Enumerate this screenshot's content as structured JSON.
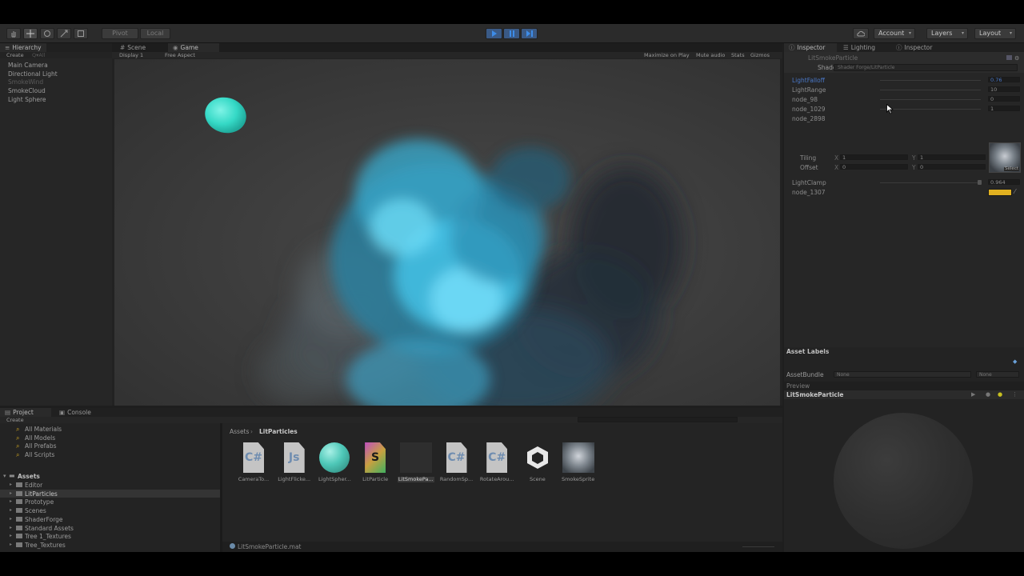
{
  "toolbar": {
    "pivot_label": "Pivot",
    "local_label": "Local",
    "account_label": "Account",
    "layers_label": "Layers",
    "layout_label": "Layout"
  },
  "hierarchy": {
    "tab_label": "Hierarchy",
    "create_label": "Create",
    "search_placeholder": "Q▾All",
    "items": [
      {
        "label": "Main Camera",
        "dim": false
      },
      {
        "label": "Directional Light",
        "dim": false
      },
      {
        "label": "SmokeWind",
        "dim": true
      },
      {
        "label": "SmokeCloud",
        "dim": false
      },
      {
        "label": "Light Sphere",
        "dim": false
      }
    ]
  },
  "view": {
    "scene_tab": "Scene",
    "game_tab": "Game",
    "display_label": "Display 1",
    "aspect_label": "Free Aspect",
    "maximize_label": "Maximize on Play",
    "mute_label": "Mute audio",
    "stats_label": "Stats",
    "gizmos_label": "Gizmos"
  },
  "inspector": {
    "tab_inspector": "Inspector",
    "tab_lighting": "Lighting",
    "tab_inspector2": "Inspector",
    "material_name": "LitSmokeParticle",
    "shader_label": "Shader",
    "shader_value": "Shader Forge/LitParticle",
    "props": [
      {
        "label": "LightFalloff",
        "value": "0.76",
        "highlight": true
      },
      {
        "label": "LightRange",
        "value": "10",
        "highlight": false
      },
      {
        "label": "node_98",
        "value": "0",
        "highlight": false
      },
      {
        "label": "node_1029",
        "value": "1",
        "highlight": false
      },
      {
        "label": "node_2898",
        "value": "",
        "highlight": false
      }
    ],
    "tiling_label": "Tiling",
    "offset_label": "Offset",
    "tiling_x": "1",
    "tiling_y": "1",
    "offset_x": "0",
    "offset_y": "0",
    "x_label": "X",
    "y_label": "Y",
    "select_label": "Select",
    "lightclamp_label": "LightClamp",
    "lightclamp_value": "0.964",
    "node1307_label": "node_1307",
    "color_swatch": "#e0b020",
    "asset_labels": "Asset Labels",
    "assetbundle_label": "AssetBundle",
    "assetbundle_value": "None",
    "assetbundle_variant": "None",
    "preview_label": "Preview",
    "preview_title": "LitSmokeParticle"
  },
  "project": {
    "tab_project": "Project",
    "tab_console": "Console",
    "create_label": "Create",
    "favorites": [
      "All Materials",
      "All Models",
      "All Prefabs",
      "All Scripts"
    ],
    "assets_root": "Assets",
    "folders": [
      {
        "label": "Editor",
        "selected": false
      },
      {
        "label": "LitParticles",
        "selected": true
      },
      {
        "label": "Prototype",
        "selected": false
      },
      {
        "label": "Scenes",
        "selected": false
      },
      {
        "label": "ShaderForge",
        "selected": false
      },
      {
        "label": "Standard Assets",
        "selected": false
      },
      {
        "label": "Tree 1_Textures",
        "selected": false
      },
      {
        "label": "Tree_Textures",
        "selected": false
      }
    ],
    "breadcrumb_root": "Assets",
    "breadcrumb_sep": "›",
    "breadcrumb_current": "LitParticles",
    "assets": [
      {
        "label": "CameraTo...",
        "icon": "csharp-script-icon",
        "glyph": "C#"
      },
      {
        "label": "LightFlicke...",
        "icon": "js-script-icon",
        "glyph": "Js"
      },
      {
        "label": "LightSpher...",
        "icon": "material-sphere-icon",
        "glyph": ""
      },
      {
        "label": "LitParticle",
        "icon": "shader-icon",
        "glyph": "S"
      },
      {
        "label": "LitSmokePa...",
        "icon": "material-icon",
        "glyph": ""
      },
      {
        "label": "RandomSp...",
        "icon": "csharp-script-icon",
        "glyph": "C#"
      },
      {
        "label": "RotateArou...",
        "icon": "csharp-script-icon",
        "glyph": "C#"
      },
      {
        "label": "Scene",
        "icon": "unity-scene-icon",
        "glyph": ""
      },
      {
        "label": "SmokeSprite",
        "icon": "texture-icon",
        "glyph": ""
      }
    ],
    "status_file": "LitSmokeParticle.mat"
  }
}
